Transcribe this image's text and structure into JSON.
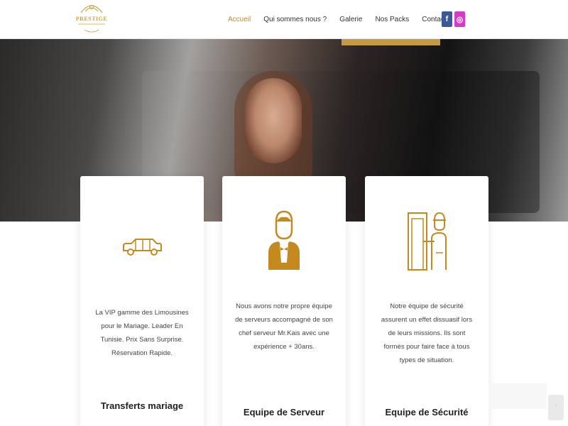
{
  "brand": {
    "logo_text": "PRESTIGE",
    "accent_color": "#c58a1f"
  },
  "nav": {
    "items": [
      {
        "label": "Accueil",
        "active": true
      },
      {
        "label": "Qui sommes nous ?",
        "active": false
      },
      {
        "label": "Galerie",
        "active": false
      },
      {
        "label": "Nos Packs",
        "active": false
      },
      {
        "label": "Contact",
        "active": false
      }
    ]
  },
  "social": {
    "facebook": "f",
    "instagram": "◎"
  },
  "cards": [
    {
      "icon": "limousine-icon",
      "text": "La VIP gamme des Limousines pour le Mariage. Leader En Tunisie. Prix Sans Surprise. Réservation Rapide.",
      "title": "Transferts mariage"
    },
    {
      "icon": "waiter-icon",
      "text": "Nous avons notre propre équipe de serveurs accompagné de son chef serveur Mr.Kais avec une expérience + 30ans.",
      "title": "Equipe de Serveur"
    },
    {
      "icon": "security-guard-icon",
      "text": "Notre équipe de sécurité assurent un effet dissuasif lors de leurs missions. Ils sont formés pour faire face à tous types de situation.",
      "title": "Equipe de Sécurité"
    }
  ],
  "widget": {
    "scroll_top_symbol": "ʿ"
  }
}
